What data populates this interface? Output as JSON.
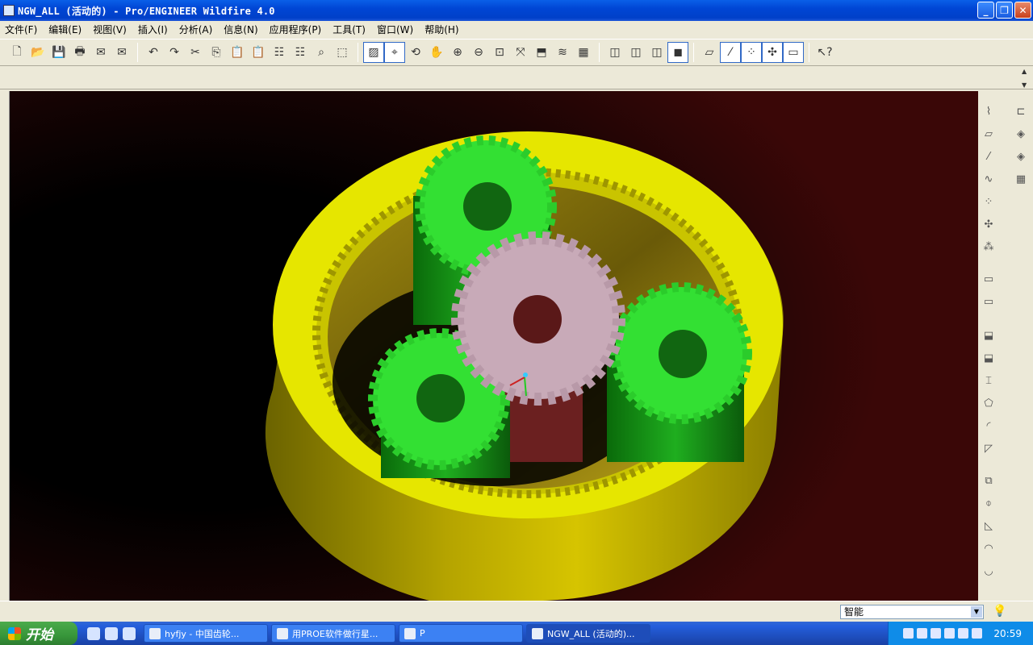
{
  "window": {
    "title": "NGW_ALL (活动的) - Pro/ENGINEER Wildfire 4.0"
  },
  "menu": [
    "文件(F)",
    "编辑(E)",
    "视图(V)",
    "插入(I)",
    "分析(A)",
    "信息(N)",
    "应用程序(P)",
    "工具(T)",
    "窗口(W)",
    "帮助(H)"
  ],
  "toolbar_icons": [
    "new-file-icon",
    "open-file-icon",
    "save-icon",
    "print-icon",
    "email-icon",
    "email-link-icon",
    "undo-icon",
    "redo-icon",
    "cut-icon",
    "copy-icon",
    "paste-icon",
    "paste-special-icon",
    "regenerate-icon",
    "regenerate-manager-icon",
    "find-icon",
    "select-box-icon",
    "repaint-icon",
    "spin-center-icon",
    "orient-mode-icon",
    "pan-icon",
    "zoom-in-icon",
    "zoom-out-icon",
    "refit-icon",
    "reorient-icon",
    "saved-views-icon",
    "layers-icon",
    "view-manager-icon",
    "wireframe-icon",
    "hidden-line-icon",
    "no-hidden-icon",
    "shading-icon",
    "datum-plane-icon",
    "datum-axis-icon",
    "datum-point-icon",
    "coordinate-system-icon",
    "annotation-icon",
    "help-context-icon"
  ],
  "status": {
    "filter_value": "智能"
  },
  "taskbar": {
    "start_label": "开始",
    "tasks": [
      "hyfjy - 中国齿轮...",
      "用PROE软件做行星...",
      "P",
      "NGW_ALL (活动的)..."
    ],
    "clock": "20:59"
  },
  "colors": {
    "ring_gear": "#E6E600",
    "planet_gear": "#33E033",
    "sun_gear": "#C8AAB8",
    "title_blue": "#0A5FE8"
  }
}
